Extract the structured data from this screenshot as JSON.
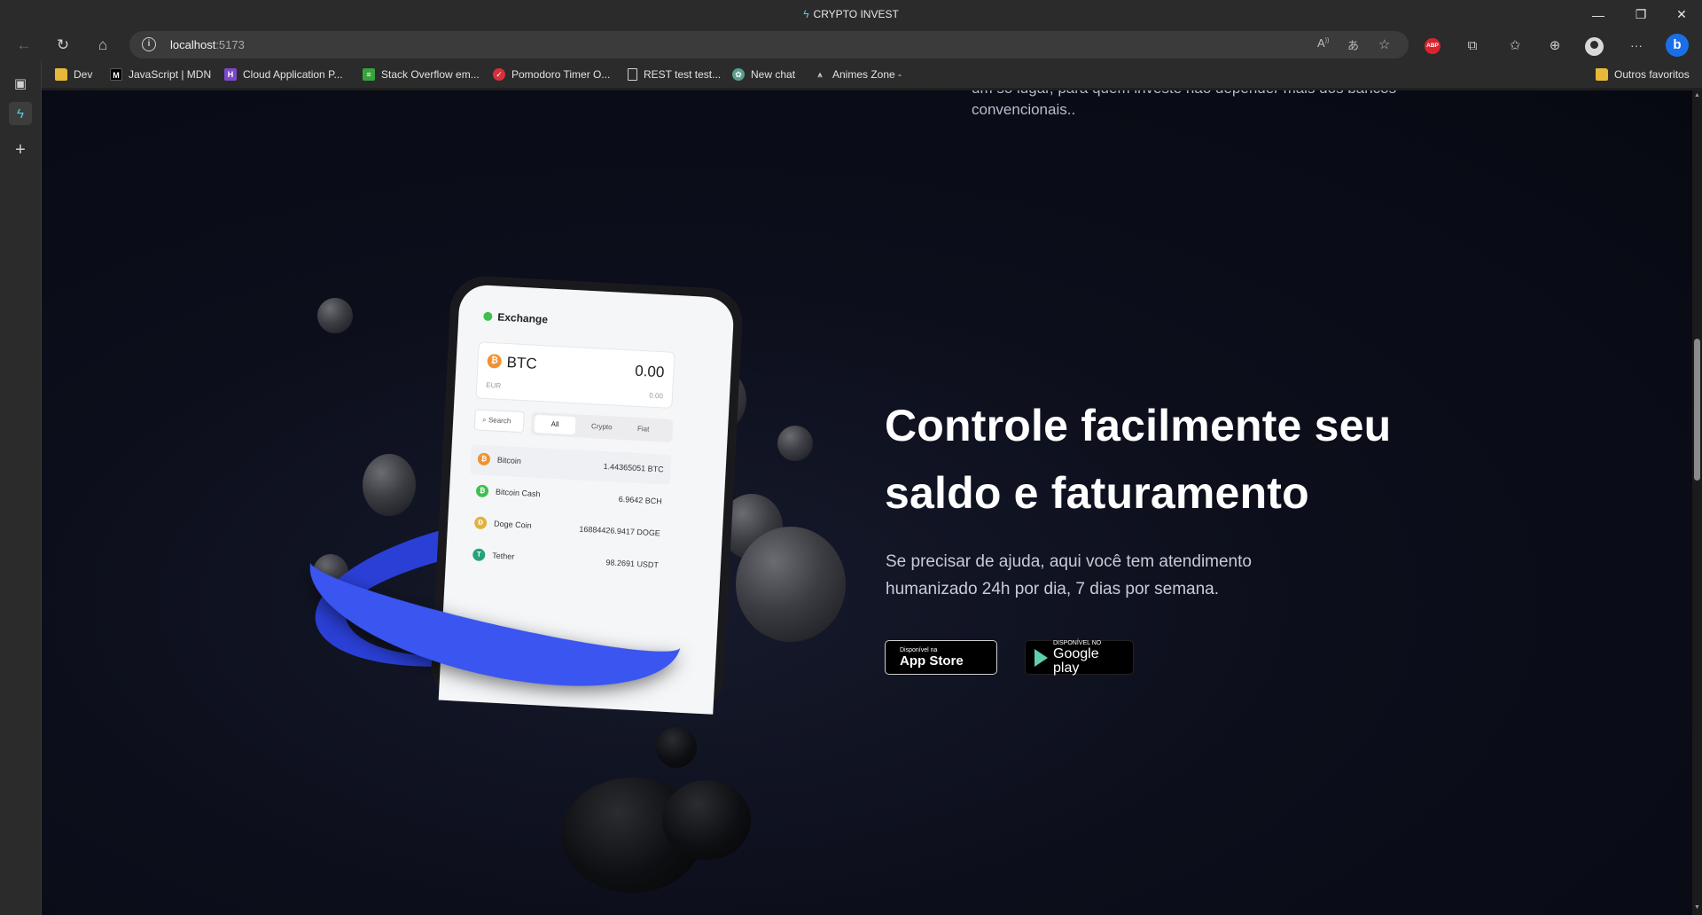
{
  "window": {
    "title": "CRYPTO INVEST",
    "controls": {
      "minimize": "—",
      "restore": "❐",
      "close": "✕"
    }
  },
  "toolbar": {
    "url_host": "localhost",
    "url_port": ":5173",
    "icons": [
      "back-icon",
      "refresh-icon",
      "home-icon",
      "info-icon",
      "read-aloud-icon",
      "translate-icon",
      "add-favorite-icon",
      "adblock-icon",
      "extensions-icon",
      "favorites-icon",
      "collections-icon",
      "profile-icon",
      "more-icon",
      "bing-icon"
    ],
    "abp_label": "ABP",
    "more_label": "···",
    "bing_label": "b"
  },
  "bookmarks": [
    {
      "label": "Dev",
      "icon": "folder-icon"
    },
    {
      "label": "JavaScript | MDN",
      "icon": "mdn-icon",
      "glyph": "M"
    },
    {
      "label": "Cloud Application P...",
      "icon": "heroku-icon",
      "glyph": "H"
    },
    {
      "label": "Stack Overflow em...",
      "icon": "stackoverflow-icon",
      "glyph": "≡"
    },
    {
      "label": "Pomodoro Timer O...",
      "icon": "pomodoro-icon",
      "glyph": "✓"
    },
    {
      "label": "REST test test...",
      "icon": "document-icon",
      "glyph": ""
    },
    {
      "label": "New chat",
      "icon": "chatgpt-icon",
      "glyph": "✿"
    },
    {
      "label": "Animes Zone -",
      "icon": "anime-icon",
      "glyph": "⩚"
    }
  ],
  "other_favorites": "Outros favoritos",
  "page": {
    "top_text": "um só lugar, para quem investe não depender mais dos bancos convencionais..",
    "hero_title": "Controle facilmente seu saldo e faturamento",
    "hero_subtitle": "Se precisar de ajuda, aqui você tem atendimento humanizado 24h por dia, 7 dias por semana.",
    "appstore": {
      "small": "Disponível na",
      "big": "App Store"
    },
    "googleplay": {
      "small": "DISPONÍVEL NO",
      "big": "Google play"
    }
  },
  "phone": {
    "header": "Exchange",
    "card": {
      "symbol": "BTC",
      "amount": "0.00",
      "fiat": "EUR",
      "fiat_amount": "0.00"
    },
    "search": "Search",
    "tabs": [
      "All",
      "Crypto",
      "Fiat"
    ],
    "rows": [
      {
        "name": "Bitcoin",
        "value": "1.44365051 BTC",
        "color": "#f0922f",
        "glyph": "₿"
      },
      {
        "name": "Bitcoin Cash",
        "value": "6.9642 BCH",
        "color": "#3fbf4f",
        "glyph": "₿"
      },
      {
        "name": "Doge Coin",
        "value": "16884426.9417 DOGE",
        "color": "#e2b23a",
        "glyph": "Ð"
      },
      {
        "name": "Tether",
        "value": "98.2691 USDT",
        "color": "#26a17b",
        "glyph": "T"
      }
    ]
  },
  "colors": {
    "page_bg": "#0c0e1b",
    "accent_ring": "#3a55f0",
    "chrome": "#2b2b2b"
  }
}
